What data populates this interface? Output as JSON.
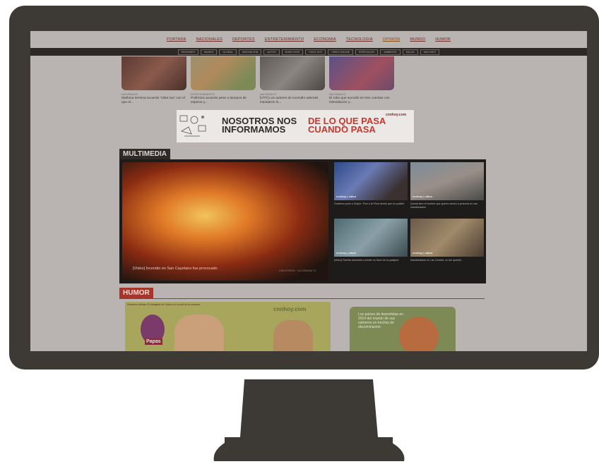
{
  "nav": {
    "main": [
      "PORTADA",
      "NACIONALES",
      "DEPORTES",
      "ENTRETENIMIENTO",
      "ECONOMIA",
      "TECNOLOGIA",
      "OPINIÓN",
      "MUNDO",
      "HUMOR"
    ],
    "sub": [
      "REGIONES",
      "MUNDO",
      "GLOBAL",
      "INNOVACION",
      "AUTOS",
      "BUEN VIVIR",
      "CHILE HOY",
      "VIDEO ONLINE",
      "ESPECIALES",
      "AMBIENTE",
      "SALUD",
      "MAS INFO"
    ]
  },
  "thumbs": [
    {
      "meta": "NACIONALES",
      "title": "Mañana termina acuerdo 'Vista Sur' con el que el..."
    },
    {
      "meta": "ENTRETENIMIENTO",
      "title": "Polémica acuerdo pese a tiempos de esperar y..."
    },
    {
      "meta": "NACIONALES",
      "title": "[VTF] Los autores de incendio además intentaron le..."
    },
    {
      "meta": "NACIONALES",
      "title": "El robo que sucedió en tres cuentas con intimidación y..."
    }
  ],
  "banner": {
    "line1a": "NOSOTROS NOS",
    "line1b": "INFORMAMOS",
    "line2a": "DE LO QUE PASA",
    "line2b": "CUANDO PASA",
    "logo": "cnnhoy.com"
  },
  "multimedia": {
    "header": "MULTIMEDIA",
    "main_caption": "[Video] Incendio en San Cayetano fue provocado",
    "main_time": "CHILEVISION · LA COMUNA TV",
    "items": [
      {
        "caption": "Gobierno pone a Chipre: 'Fiso a la Flora dentro que es posible'"
      },
      {
        "caption": "Queda libre el hombre que quemó dentro a persona en una manifestación"
      },
      {
        "caption": "[Video] Familia arremetió a chofer en favor de la pasajera"
      },
      {
        "caption": "Manifestación en Las Condes: un ser querido"
      }
    ],
    "badge": "cnnhoy | video"
  },
  "humor": {
    "header": "HUMOR",
    "comic_caption": "Nuestras viñetas: El dibujante de Tontos en la web de la semana",
    "comic_brand": "cnnhoy.com",
    "comic_label": "Papas",
    "side_text": "Los países de deportistas en 2014 del mundo de sus números en hechos de discriminación"
  },
  "colors": {
    "accent": "#a6352b",
    "monitor": "#3d3a36",
    "screen_bg": "#b9b3b1"
  }
}
